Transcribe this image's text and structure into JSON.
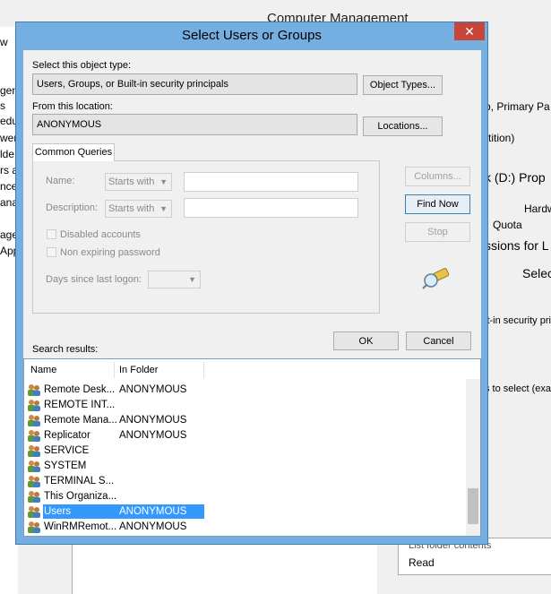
{
  "background": {
    "window_title": "Computer Management",
    "left_fragments": [
      "w",
      "gen",
      "s",
      "edu",
      "wer",
      "lde",
      "rs a",
      "nce",
      "ana",
      "age",
      "App"
    ],
    "right_fragments": [
      "p, Primary Pa",
      "rtition)",
      "k (D:) Prop",
      "Hardw",
      "Quota",
      "ssions for L",
      "Selec",
      ":",
      "lt-in security princi",
      "s to select (exa"
    ],
    "bottom_fragments": [
      "List folder contents",
      "Read"
    ]
  },
  "dialog": {
    "title": "Select Users or Groups",
    "close_glyph": "✕",
    "object_type_label": "Select this object type:",
    "object_type_value": "Users, Groups, or Built-in security principals",
    "object_types_button": "Object Types...",
    "location_label": "From this location:",
    "location_value": "ANONYMOUS",
    "locations_button": "Locations...",
    "tab_label": "Common Queries",
    "name_label": "Name:",
    "name_combo": "Starts with",
    "description_label": "Description:",
    "description_combo": "Starts with",
    "disabled_accounts": "Disabled accounts",
    "non_expiring": "Non expiring password",
    "days_label": "Days since last logon:",
    "columns_button": "Columns...",
    "find_now_button": "Find Now",
    "stop_button": "Stop",
    "ok_button": "OK",
    "cancel_button": "Cancel",
    "search_results_label": "Search results:"
  },
  "results": {
    "columns": [
      "Name",
      "In Folder"
    ],
    "rows": [
      {
        "name": "Remote Desk...",
        "folder": "ANONYMOUS"
      },
      {
        "name": "REMOTE INT...",
        "folder": ""
      },
      {
        "name": "Remote Mana...",
        "folder": "ANONYMOUS"
      },
      {
        "name": "Replicator",
        "folder": "ANONYMOUS"
      },
      {
        "name": "SERVICE",
        "folder": ""
      },
      {
        "name": "SYSTEM",
        "folder": ""
      },
      {
        "name": "TERMINAL S...",
        "folder": ""
      },
      {
        "name": "This Organiza...",
        "folder": ""
      },
      {
        "name": "Users",
        "folder": "ANONYMOUS"
      },
      {
        "name": "WinRMRemot...",
        "folder": "ANONYMOUS"
      }
    ],
    "selected_index": 8
  },
  "colors": {
    "dialog_frame": "#75aee0",
    "close_button": "#c7463a",
    "selection": "#3399ff"
  },
  "icons": [
    "close-icon",
    "search-flashlight-icon",
    "user-group-icon",
    "chevron-down-icon"
  ]
}
